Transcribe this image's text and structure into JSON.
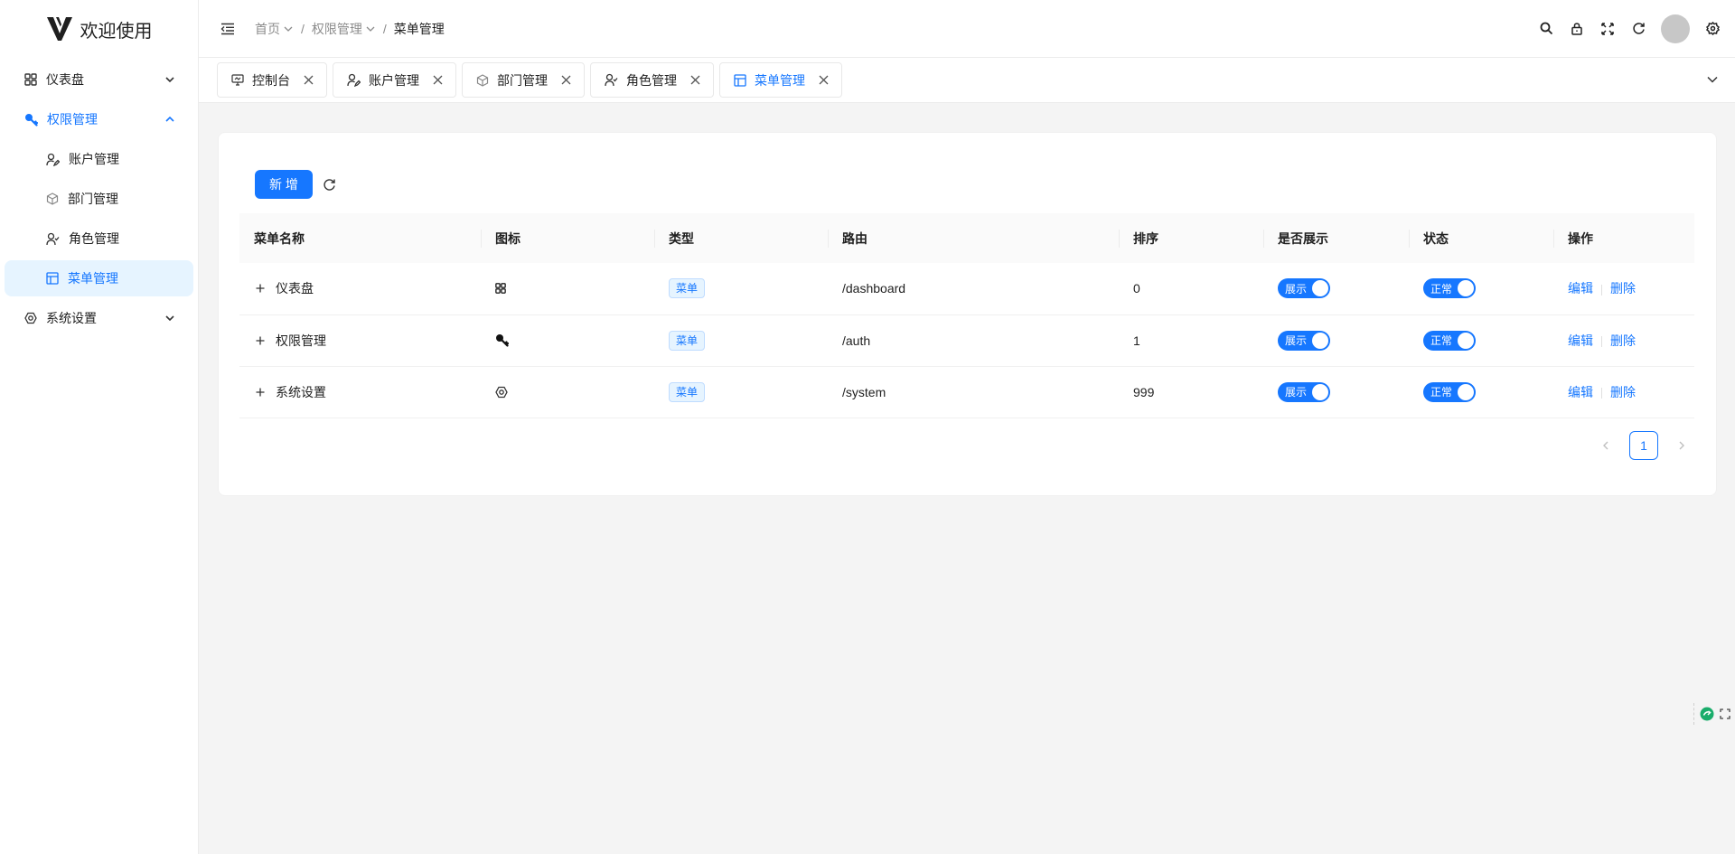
{
  "app": {
    "title": "欢迎使用"
  },
  "sidebar": {
    "items": [
      {
        "label": "仪表盘",
        "icon": "dashboard-icon"
      },
      {
        "label": "权限管理",
        "icon": "key-icon",
        "children": [
          {
            "label": "账户管理",
            "icon": "user-edit-icon"
          },
          {
            "label": "部门管理",
            "icon": "cube-icon"
          },
          {
            "label": "角色管理",
            "icon": "user-role-icon"
          },
          {
            "label": "菜单管理",
            "icon": "table-icon",
            "active": true
          }
        ]
      },
      {
        "label": "系统设置",
        "icon": "settings-icon"
      }
    ]
  },
  "breadcrumb": {
    "home": "首页",
    "section": "权限管理",
    "current": "菜单管理"
  },
  "tabs": [
    {
      "label": "控制台",
      "icon": "monitor-icon"
    },
    {
      "label": "账户管理",
      "icon": "user-edit-icon"
    },
    {
      "label": "部门管理",
      "icon": "cube-icon"
    },
    {
      "label": "角色管理",
      "icon": "user-role-icon"
    },
    {
      "label": "菜单管理",
      "icon": "table-icon",
      "active": true
    }
  ],
  "toolbar": {
    "add_label": "新 增"
  },
  "table": {
    "columns": [
      "菜单名称",
      "图标",
      "类型",
      "路由",
      "排序",
      "是否展示",
      "状态",
      "操作"
    ],
    "rows": [
      {
        "name": "仪表盘",
        "icon": "dashboard-icon",
        "type": "菜单",
        "route": "/dashboard",
        "order": "0",
        "show": "展示",
        "status": "正常",
        "edit": "编辑",
        "delete": "删除"
      },
      {
        "name": "权限管理",
        "icon": "key-icon",
        "type": "菜单",
        "route": "/auth",
        "order": "1",
        "show": "展示",
        "status": "正常",
        "edit": "编辑",
        "delete": "删除"
      },
      {
        "name": "系统设置",
        "icon": "settings-icon",
        "type": "菜单",
        "route": "/system",
        "order": "999",
        "show": "展示",
        "status": "正常",
        "edit": "编辑",
        "delete": "删除"
      }
    ]
  },
  "pagination": {
    "current": "1"
  },
  "colors": {
    "primary": "#1677ff",
    "active_bg": "#e6f4ff",
    "page_bg": "#f4f4f4"
  }
}
